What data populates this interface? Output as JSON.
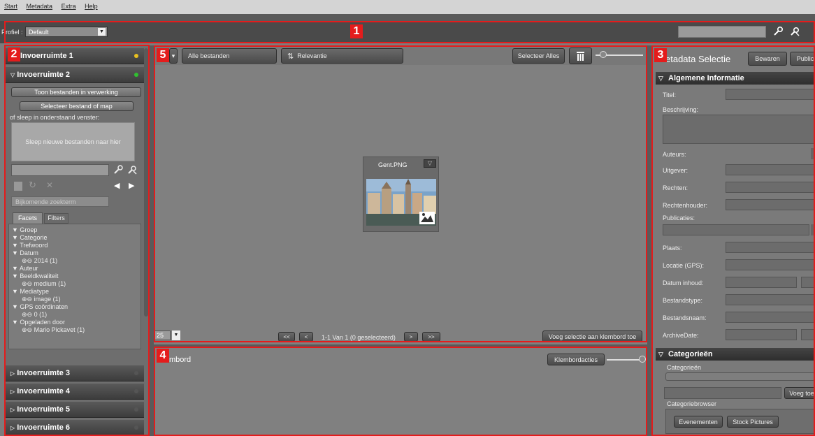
{
  "menu": [
    "Start",
    "Metadata",
    "Extra",
    "Help"
  ],
  "toolbar": {
    "profile_label": "Profiel :",
    "profile_value": "Default",
    "search_value": ""
  },
  "badges": [
    "1",
    "2",
    "3",
    "4",
    "5"
  ],
  "left": {
    "ir1": "Invoerruimte 1",
    "ir2": "Invoerruimte 2",
    "btn_processing": "Toon bestanden in verwerking",
    "btn_select": "Selecteer bestand of map",
    "drag_hint": "of sleep in onderstaand venster:",
    "drop_zone": "Sleep nieuwe bestanden naar hier",
    "extra_term_placeholder": "Bijkomende zoekterm",
    "tab_facets": "Facets",
    "tab_filters": "Filters",
    "facets": {
      "groep": "Groep",
      "categorie": "Categorie",
      "trefwoord": "Trefwoord",
      "datum": "Datum",
      "datum_val": "2014 (1)",
      "auteur": "Auteur",
      "beeld": "Beeldkwaliteit",
      "beeld_val": "medium (1)",
      "media": "Mediatype",
      "media_val": "image (1)",
      "gps": "GPS coördinaten",
      "gps_val": "0 (1)",
      "opgeladen": "Opgeladen door",
      "opgeladen_val": "Mario Pickavet (1)"
    },
    "ir3": "Invoerruimte 3",
    "ir4": "Invoerruimte 4",
    "ir5": "Invoerruimte 5",
    "ir6": "Invoerruimte 6"
  },
  "center": {
    "all_files": "Alle bestanden",
    "relevance": "Relevantie",
    "select_all": "Selecteer Alles",
    "thumb_name": "Gent.PNG",
    "page_size": "25",
    "first": "<<",
    "prev": "<",
    "page_info": "1-1 Van 1  (0 geselecteerd)",
    "next": ">",
    "last": ">>",
    "add_clipboard": "Voeg selectie aan klembord toe",
    "clipboard_title": "mbord",
    "clipboard_actions": "Klembordacties"
  },
  "right": {
    "title": "etadata Selectie",
    "save": "Bewaren",
    "publish": "Public",
    "sec_general": "Algemene Informatie",
    "titel": "Titel:",
    "beschrijving": "Beschrijving:",
    "auteurs": "Auteurs:",
    "uitgever": "Uitgever:",
    "rechten": "Rechten:",
    "rechtenhouder": "Rechtenhouder:",
    "publicaties": "Publicaties:",
    "plaats": "Plaats:",
    "locatie": "Locatie (GPS):",
    "datum_inhoud": "Datum inhoud:",
    "bestandstype": "Bestandstype:",
    "bestandsnaam": "Bestandsnaam:",
    "archivedate": "ArchiveDate:",
    "sec_categories": "Categorieën",
    "categorieen": "Categorieën",
    "voeg_toe": "Voeg toe",
    "categoriebrowser": "Categoriebrowser",
    "evenementen": "Evenementen",
    "stock": "Stock Pictures"
  },
  "colors": {
    "annotation": "#e41c1c",
    "dot_yellow": "#e8c020",
    "dot_green": "#30c030"
  }
}
